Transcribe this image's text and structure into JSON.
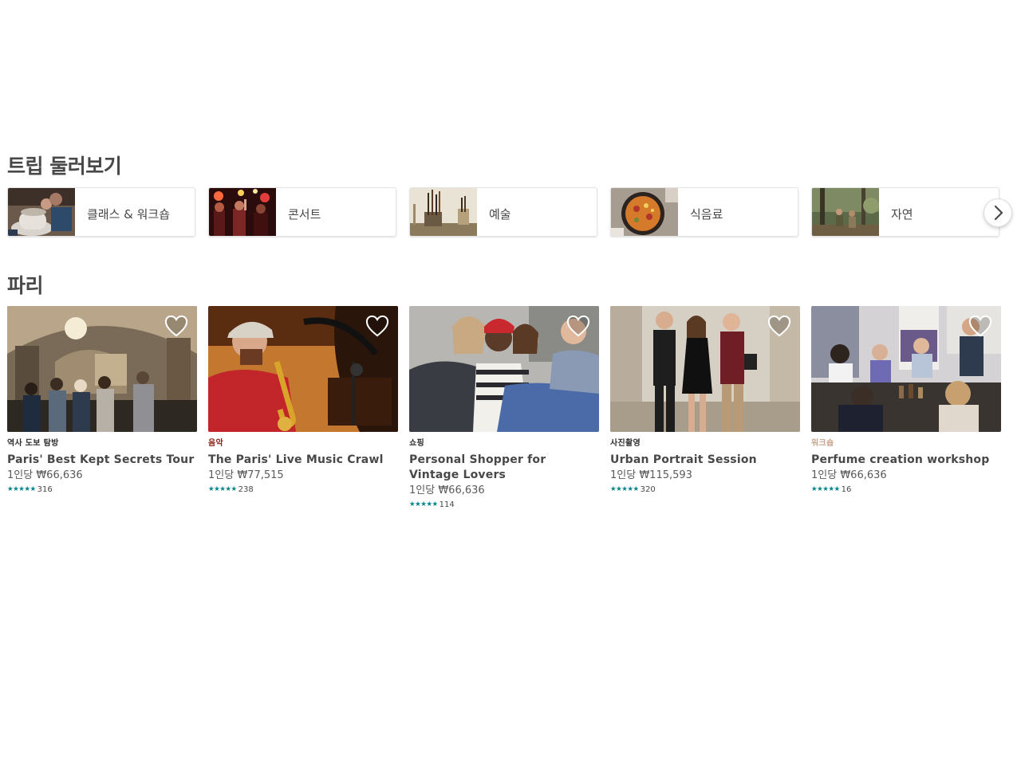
{
  "trips_section": {
    "title": "트립 둘러보기",
    "categories": [
      {
        "label": "클래스 & 워크숍",
        "thumb": "pottery-wheel-photo"
      },
      {
        "label": "콘서트",
        "thumb": "concert-crowd-photo"
      },
      {
        "label": "예술",
        "thumb": "paint-brushes-photo"
      },
      {
        "label": "식음료",
        "thumb": "paella-pan-photo"
      },
      {
        "label": "자연",
        "thumb": "forest-hikers-photo"
      }
    ],
    "next_icon": "chevron-right-icon"
  },
  "paris_section": {
    "title": "파리",
    "experiences": [
      {
        "category": "역사 도보 탐방",
        "category_color": "#2d2d2d",
        "title": "Paris' Best Kept Secrets Tour",
        "price": "1인당 ₩66,636",
        "stars": "★★★★★",
        "reviews": "316",
        "photo": "church-interior-photo"
      },
      {
        "category": "음악",
        "category_color": "#8a1f11",
        "title": "The Paris' Live Music Crawl",
        "price": "1인당 ₩77,515",
        "stars": "★★★★★",
        "reviews": "238",
        "photo": "saxophone-player-photo"
      },
      {
        "category": "쇼핑",
        "category_color": "#2d2d2d",
        "title": "Personal Shopper for Vintage Lovers",
        "price": "1인당 ₩66,636",
        "stars": "★★★★★",
        "reviews": "114",
        "photo": "vintage-shopping-photo"
      },
      {
        "category": "사진촬영",
        "category_color": "#2d2d2d",
        "title": "Urban Portrait Session",
        "price": "1인당 ₩115,593",
        "stars": "★★★★★",
        "reviews": "320",
        "photo": "portrait-group-photo"
      },
      {
        "category": "워크숍",
        "category_color": "#c9a58d",
        "title": "Perfume creation workshop",
        "price": "1인당 ₩66,636",
        "stars": "★★★★★",
        "reviews": "16",
        "photo": "perfume-workshop-photo"
      }
    ],
    "wishlist_icon": "heart-outline-icon",
    "star_color": "#008489"
  }
}
